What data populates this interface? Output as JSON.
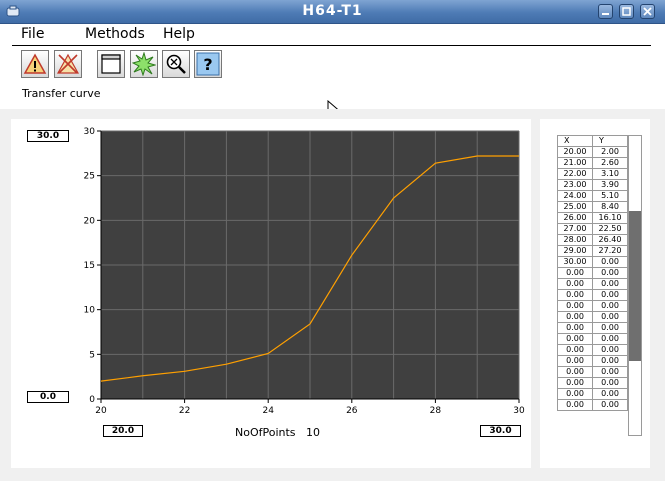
{
  "window": {
    "title": "H64-T1"
  },
  "menu": {
    "file": "File",
    "methods": "Methods",
    "help": "Help"
  },
  "toolbar": {
    "icons": [
      "warning-icon",
      "clear-warning-icon",
      "window-icon",
      "star-burst-icon",
      "magnifier-icon",
      "help-icon"
    ],
    "help_glyph": "?"
  },
  "caption": "Transfer curve",
  "plot": {
    "y_max_box": "30.0",
    "y_min_box": "0.0",
    "x_min_box": "20.0",
    "x_max_box": "30.0",
    "x_title": "NoOfPoints",
    "x_title_value": "10",
    "colors": {
      "background": "#404040",
      "grid": "#6a6a6a",
      "line": "#ffa000"
    }
  },
  "chart_data": {
    "type": "line",
    "x": [
      20,
      21,
      22,
      23,
      24,
      25,
      26,
      27,
      28,
      29,
      30
    ],
    "series": [
      {
        "values": [
          2.0,
          2.6,
          3.1,
          3.9,
          5.1,
          8.4,
          16.1,
          22.5,
          26.4,
          27.2,
          27.2
        ]
      }
    ],
    "xlim": [
      20,
      30
    ],
    "ylim": [
      0,
      30
    ],
    "xticks": [
      "20",
      "22",
      "24",
      "26",
      "28",
      "30"
    ],
    "yticks": [
      "0",
      "5",
      "10",
      "15",
      "20",
      "25",
      "30"
    ],
    "grid": true
  },
  "table": {
    "headers": [
      "X",
      "Y"
    ],
    "rows": [
      [
        "20.00",
        "2.00"
      ],
      [
        "21.00",
        "2.60"
      ],
      [
        "22.00",
        "3.10"
      ],
      [
        "23.00",
        "3.90"
      ],
      [
        "24.00",
        "5.10"
      ],
      [
        "25.00",
        "8.40"
      ],
      [
        "26.00",
        "16.10"
      ],
      [
        "27.00",
        "22.50"
      ],
      [
        "28.00",
        "26.40"
      ],
      [
        "29.00",
        "27.20"
      ],
      [
        "30.00",
        "0.00"
      ],
      [
        "0.00",
        "0.00"
      ],
      [
        "0.00",
        "0.00"
      ],
      [
        "0.00",
        "0.00"
      ],
      [
        "0.00",
        "0.00"
      ],
      [
        "0.00",
        "0.00"
      ],
      [
        "0.00",
        "0.00"
      ],
      [
        "0.00",
        "0.00"
      ],
      [
        "0.00",
        "0.00"
      ],
      [
        "0.00",
        "0.00"
      ],
      [
        "0.00",
        "0.00"
      ],
      [
        "0.00",
        "0.00"
      ],
      [
        "0.00",
        "0.00"
      ],
      [
        "0.00",
        "0.00"
      ]
    ],
    "scroll_position": 0.5
  }
}
